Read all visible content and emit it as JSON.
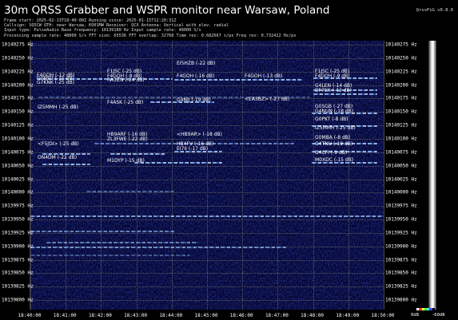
{
  "header": {
    "title": "30m QRSS Grabber and WSPR monitor near Warsaw, Poland",
    "version": "QrssPiG v0.8.0",
    "info_lines": [
      "Frame start: 2025-02-13T18:40:00Z Running since: 2025-01-15T12:20:31Z",
      "Callsign: SQ5CW QTH: near Warsaw, KO01MW Receiver: QCX Antenna: Vertical with elev. radial",
      "Input type: PulseAudio Base frequency: 10139180 Hz Input sample rate: 48000 S/s",
      "Processing sample rate: 48000 S/s FFT size: 65536 FFT overlap: 32768 Time res: 0.682667 s/px Freq res: 0.732422 Hz/px"
    ]
  },
  "y_axis": {
    "labels": [
      "10140275 Hz",
      "10140250 Hz",
      "10140225 Hz",
      "10140200 Hz",
      "10140175 Hz",
      "10140150 Hz",
      "10140125 Hz",
      "10140100 Hz",
      "10140075 Hz",
      "10140050 Hz",
      "10140025 Hz",
      "10140000 Hz",
      "10139975 Hz",
      "10139950 Hz",
      "10139925 Hz",
      "10139900 Hz",
      "10139875 Hz",
      "10139850 Hz",
      "10139825 Hz",
      "10139800 Hz"
    ]
  },
  "x_axis": {
    "labels": [
      "18:40:00",
      "18:41:00",
      "18:42:00",
      "18:43:00",
      "18:44:00",
      "18:45:00",
      "18:46:00",
      "18:47:00",
      "18:48:00",
      "18:49:00",
      "18:50:00"
    ]
  },
  "signals": [
    {
      "id": "F4GOH-1",
      "text": "F4GOH (-12 dB)"
    },
    {
      "id": "G0FBD",
      "text": "G0FBD (-15 dB)"
    },
    {
      "id": "G7KNK",
      "text": "G7KNK (-25 dB)"
    },
    {
      "id": "F1JSC-1",
      "text": "F1JSC (-25 dB)"
    },
    {
      "id": "F4GOH-2",
      "text": "F4GOH (-9 dB)"
    },
    {
      "id": "RA1ZN",
      "text": "RA1ZN (-24 dB)"
    },
    {
      "id": "EI5HZB",
      "text": "EI5HZB (-22 dB)"
    },
    {
      "id": "F4GOH-3",
      "text": "F4GOH (-16 dB)"
    },
    {
      "id": "F4GOH-4",
      "text": "F4GOH (-13 dB)"
    },
    {
      "id": "F1JSC-2",
      "text": "F1JSC (-25 dB)"
    },
    {
      "id": "F4GOH-5",
      "text": "F4GOH (-9 dB)"
    },
    {
      "id": "G4LEN",
      "text": "G4LEN (-14 dB)"
    },
    {
      "id": "DF7EX",
      "text": "DF7EX (-12 dB)"
    },
    {
      "id": "IZ5MMH-1",
      "text": "IZ5MMH (-25 dB)"
    },
    {
      "id": "F4ASK",
      "text": "F4ASK (-25 dB)"
    },
    {
      "id": "G4NJJ",
      "text": "G4NJJ (-19 dB)"
    },
    {
      "id": "EA3BZ",
      "text": "<EA3BZ> (-27 dB)"
    },
    {
      "id": "G0SGB",
      "text": "G0SGB (-27 dB)"
    },
    {
      "id": "G4NUN",
      "text": "G4NUN (-18 dB)"
    },
    {
      "id": "G0PKT",
      "text": "G0PKT (-8 dB)"
    },
    {
      "id": "IZ5MMH-2",
      "text": "IZ5MMH (-25 dB)"
    },
    {
      "id": "HB9ARF",
      "text": "HB9ARF (-16 dB)"
    },
    {
      "id": "ZL3FWE",
      "text": "ZL3FWE (-22 dB)"
    },
    {
      "id": "HB9AR",
      "text": "<HB9AR> (-18 dB)"
    },
    {
      "id": "HB4FV",
      "text": "HB4FV (-16 dB)"
    },
    {
      "id": "EI7II",
      "text": "EI7II (-17 dB)"
    },
    {
      "id": "G0MBA",
      "text": "G0MBA (-8 dB)"
    },
    {
      "id": "G4TNU",
      "text": "G4TNU (-19 dB)"
    },
    {
      "id": "F5JDI",
      "text": "<F5JDI> (-25 dB)"
    },
    {
      "id": "G4CFI",
      "text": "G4CFI (-9 dB)"
    },
    {
      "id": "ON4DM",
      "text": "ON4DM (-22 dB)"
    },
    {
      "id": "M1DYP",
      "text": "M1DYP (-15 dB)"
    },
    {
      "id": "M0XDC",
      "text": "M0XDC (-15 dB)"
    }
  ],
  "side_scale": {
    "left": "0dB",
    "right": "-60dB"
  }
}
